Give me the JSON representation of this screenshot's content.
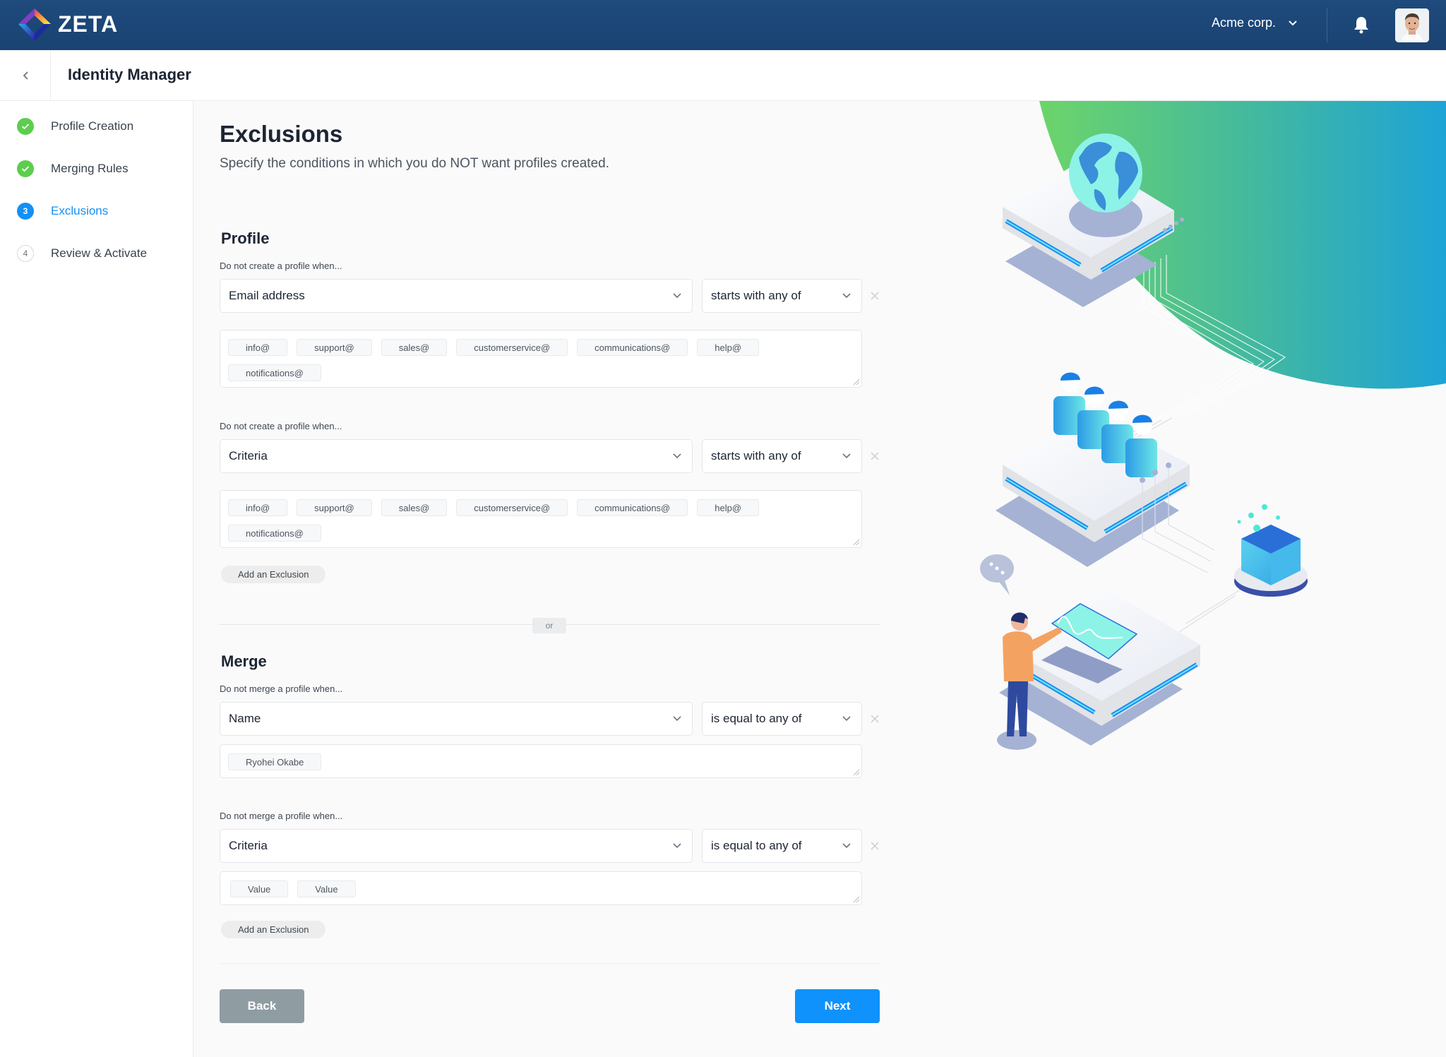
{
  "topbar": {
    "brand": "ZETA",
    "org_name": "Acme corp.",
    "icons": {
      "logo": "zeta-diamond-logo",
      "org_dropdown": "chevron-down-icon",
      "notifications": "bell-icon",
      "avatar": "user-avatar"
    }
  },
  "header": {
    "back_icon": "chevron-left-icon",
    "title": "Identity Manager"
  },
  "sidebar": {
    "steps": [
      {
        "label": "Profile Creation",
        "state": "completed",
        "badge": "check-icon"
      },
      {
        "label": "Merging Rules",
        "state": "completed",
        "badge": "check-icon"
      },
      {
        "label": "Exclusions",
        "state": "active",
        "badge": "3"
      },
      {
        "label": "Review & Activate",
        "state": "pending",
        "badge": "4"
      }
    ]
  },
  "main": {
    "title": "Exclusions",
    "subtitle": "Specify the conditions in which you do NOT want profiles created.",
    "profile": {
      "heading": "Profile",
      "rules": [
        {
          "label": "Do not create a profile when...",
          "field": "Email address",
          "operator": "starts with any of",
          "values": [
            "info@",
            "support@",
            "sales@",
            "customerservice@",
            "communications@",
            "help@",
            "notifications@"
          ]
        },
        {
          "label": "Do not create a profile when...",
          "field": "Criteria",
          "operator": "starts with any of",
          "values": [
            "info@",
            "support@",
            "sales@",
            "customerservice@",
            "communications@",
            "help@",
            "notifications@"
          ]
        }
      ],
      "add_label": "Add an Exclusion"
    },
    "or_label": "or",
    "merge": {
      "heading": "Merge",
      "rules": [
        {
          "label": "Do not merge a profile when...",
          "field": "Name",
          "operator": "is equal to any of",
          "values": [
            "Ryohei Okabe"
          ]
        },
        {
          "label": "Do not merge a profile when...",
          "field": "Criteria",
          "operator": "is equal to any of",
          "values": [
            "Value",
            "Value"
          ]
        }
      ],
      "add_label": "Add an Exclusion"
    },
    "footer": {
      "back_label": "Back",
      "next_label": "Next"
    }
  },
  "colors": {
    "topbar": "#1d4778",
    "accent": "#0f92fb",
    "step_done": "#5dcd4f",
    "step_active": "#1490f4",
    "back_button": "#8f9da3",
    "illustration_gradient_start": "#6dd46a",
    "illustration_gradient_end": "#1ea3d6"
  }
}
